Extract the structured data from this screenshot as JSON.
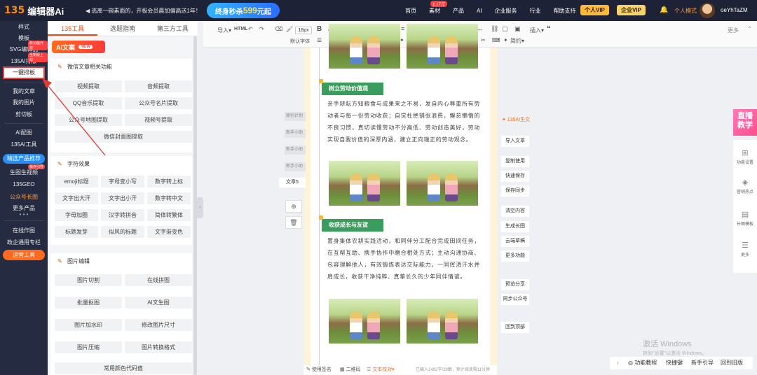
{
  "topbar": {
    "logo_mark": "135",
    "logo_text": "编辑器Ai",
    "notice": "◀ 逃离一碗素面的，开极会员晨加偏高送1年！",
    "promo_prefix": "终身秒杀",
    "promo_price": "599",
    "promo_suffix": "元起",
    "nav": [
      "首页",
      "素材",
      "产品",
      "AI",
      "企业服务",
      "行业",
      "帮助支持"
    ],
    "nav_badge": "1.17元",
    "vip_personal": "个人VIP",
    "vip_enterprise": "企业VIP",
    "mode": "个人模式",
    "username": "oeYhTaZM"
  },
  "leftnav": {
    "items": [
      "样式",
      "模板",
      "SVG编辑器",
      "135AI排版",
      "一键排板",
      "我的文章",
      "我的图片",
      "剪切板",
      "AI配图",
      "135AI工具",
      "精选产品推荐",
      "生图生视频",
      "135GEO",
      "公众号长图",
      "更多产品",
      "在线作图",
      "政企通用专栏",
      "运营工具"
    ],
    "tags": [
      "新功能开放",
      "全新版上线",
      "操作引导"
    ]
  },
  "tools": {
    "tabs": [
      "135工具",
      "选题指南",
      "第三方工具"
    ],
    "ai_label": "AI文案",
    "ai_new": "NEW",
    "wechat": {
      "title": "微信文章相关功能",
      "buttons": [
        "视频提取",
        "音频提取",
        "QQ音乐提取",
        "公众号名片提取",
        "公众号地图提取",
        "视频号提取",
        "微信封面图提取"
      ]
    },
    "chars": {
      "title": "字符效果",
      "buttons": [
        "emoji标题",
        "字母变小写",
        "数字转上标",
        "文字出大汗",
        "文字出小汗",
        "数字转中文",
        "字母加圈",
        "汉字转拼音",
        "简体转繁体",
        "标题发芽",
        "似风的标题",
        "文字渐变色"
      ]
    },
    "images": {
      "title": "图片编辑",
      "buttons": [
        "图片切割",
        "在线拼图",
        "批量抠图",
        "AI文生图",
        "图片加水印",
        "修改图片尺寸",
        "图片压缩",
        "图片转换格式",
        "常用颜色代码值"
      ]
    }
  },
  "editor_toolbar": {
    "import": "导入▾",
    "html": "HTML",
    "font_size": "18px",
    "font_name": "默认字体",
    "insert": "插入▾",
    "bullet": "简约▾",
    "more": "更多"
  },
  "article": {
    "sections": [
      {
        "title": "树立劳动价值观",
        "text": "亲手耕耘方知粮食与成果来之不易，发自内心尊重所有劳动者与每一份劳动收获；自觉杜绝铺张浪费，懈怠懒惰的不良习惯，真切读懂劳动不分高低、劳动创造美好，劳动实现自我价值的深厚内涵，建立正向端正的劳动观念。"
      },
      {
        "title": "收获成长与友谊",
        "text": "置身集体农耕实践活动，和同伴分工配合完成田间任务，在互帮互助、携手协作中磨合相处方式；主动沟通协商、包容理解他人，有效锻炼表达交际能力，一同挥洒汗水并肩成长，收获干净纯粹、真挚长久的少年同伴情谊。"
      }
    ]
  },
  "floating_left": {
    "ghosts": [
      "原创计划",
      "新手小助",
      "新手小助",
      "新手小助"
    ],
    "doc": "文章5",
    "add": "⊕",
    "delete": "🗑"
  },
  "right_actions": {
    "ai": "✦ 135AI生文",
    "buttons": [
      "导入文章",
      "复制使用",
      "快速保存",
      "保存同步",
      "清空内容",
      "生成长图",
      "云端草稿",
      "更多功能",
      "预览分享",
      "同步公众号",
      "回到顶部"
    ]
  },
  "right_panel": {
    "live": "直播\n教学",
    "items": [
      "功能设置",
      "营销热点",
      "长图模板",
      "更多"
    ]
  },
  "status": {
    "signature": "使用签名",
    "qrcode": "二维码",
    "proof": "文本校对▾",
    "count": "已输入1492字/29图，预计阅读需11分钟"
  },
  "bottom_help": [
    "功能教程",
    "快捷键",
    "新手引导",
    "回到旧版"
  ],
  "watermark": {
    "line1": "激活 Windows",
    "line2": "转到\"设置\"以激活 Windows。"
  }
}
